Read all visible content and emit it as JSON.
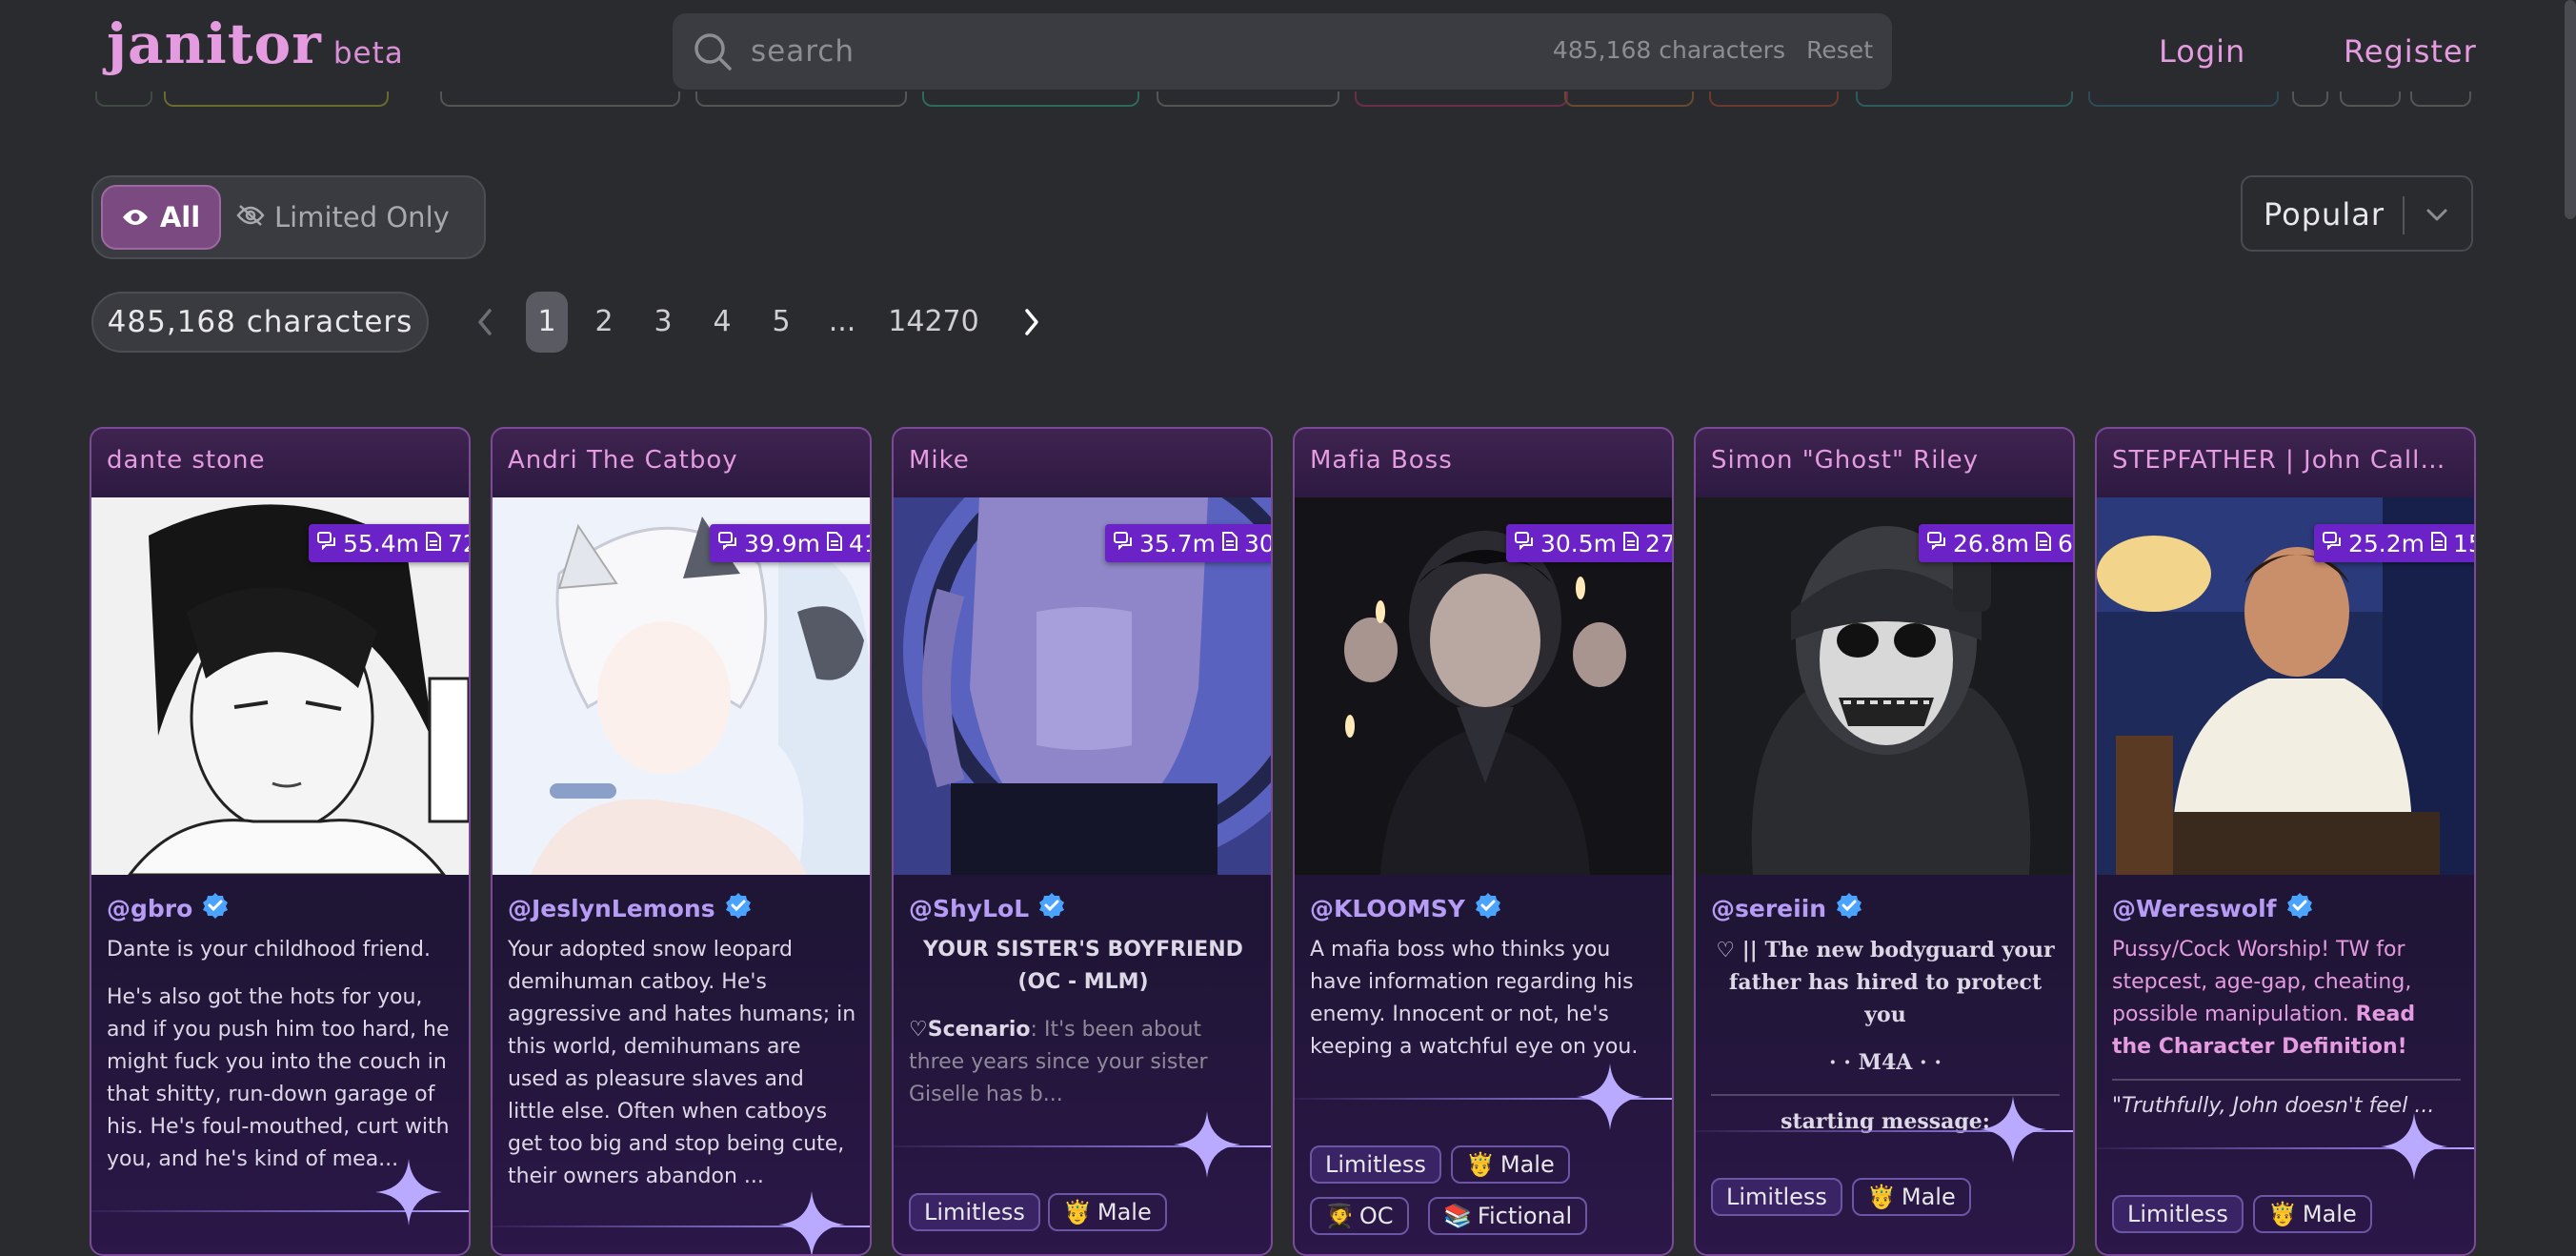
{
  "header": {
    "logo": "janitor",
    "beta": "beta",
    "search_placeholder": "search",
    "search_count": "485,168 characters",
    "reset": "Reset",
    "login": "Login",
    "register": "Register"
  },
  "filters": {
    "all": "All",
    "limited_only": "Limited Only",
    "sort": "Popular"
  },
  "count_badge": "485,168 characters",
  "pagination": {
    "pages": [
      "1",
      "2",
      "3",
      "4",
      "5",
      "...",
      "14270"
    ],
    "current": "1"
  },
  "colors": {
    "accent_pink": "#e59be0",
    "stats_purple": "#6b22c7",
    "author_purple": "#b79cf5",
    "background": "#2a2b2f"
  },
  "cards": [
    {
      "title": "dante stone",
      "chats": "55.4m",
      "messages": "72",
      "author": "@gbro",
      "desc": [
        "Dante is your childhood friend.",
        "He's also got the hots for you, and if you push him too hard, he might fuck you into the couch in that shitty, run-down garage of his. He's foul-mouthed, curt with you, and he's kind of mea..."
      ],
      "tags": []
    },
    {
      "title": "Andri The Catboy",
      "chats": "39.9m",
      "messages": "41",
      "author": "@JeslynLemons",
      "desc": [
        "Your adopted snow leopard demihuman catboy. He's aggressive and hates humans; in this world, demihumans are used as pleasure slaves and little else. Often when catboys get too big and stop being cute, their owners abandon ..."
      ],
      "tags": []
    },
    {
      "title": "Mike",
      "chats": "35.7m",
      "messages": "30",
      "author": "@ShyLoL",
      "heading": "YOUR SISTER'S BOYFRIEND (OC - MLM)",
      "scenario_label": "♡Scenario",
      "scenario_text": ": It's been about three years since your sister Giselle has b...",
      "tags": [
        {
          "icon": "🤴",
          "label": "Limitless"
        },
        {
          "icon": "🤴",
          "label": "Male"
        }
      ]
    },
    {
      "title": "Mafia Boss",
      "chats": "30.5m",
      "messages": "27",
      "author": "@KLOOMSY",
      "desc": [
        "A mafia boss who thinks you have information regarding his enemy. Innocent or not, he's keeping a watchful eye on you."
      ],
      "tags": [
        {
          "icon": "",
          "label": "Limitless"
        },
        {
          "icon": "🤴",
          "label": "Male"
        },
        {
          "icon": "🧑‍🎓",
          "label": "OC"
        },
        {
          "icon": "📚",
          "label": "Fictional"
        }
      ]
    },
    {
      "title": "Simon \"Ghost\" Riley",
      "chats": "26.8m",
      "messages": "6",
      "author": "@sereiin",
      "heading": "♡ || The new bodyguard your father has hired to protect you",
      "subheading": "· · M4A · ·",
      "footer": "starting message:",
      "tags": [
        {
          "icon": "",
          "label": "Limitless"
        },
        {
          "icon": "🤴",
          "label": "Male"
        }
      ]
    },
    {
      "title": "STEPFATHER | John Callow...",
      "chats": "25.2m",
      "messages": "15",
      "author": "@Wereswolf",
      "warning": "Pussy/Cock Worship! TW for stepcest, age-gap, cheating, possible manipulation.",
      "warning_strong": "Read the Character Definition!",
      "quote": "\"Truthfully, John doesn't feel ...",
      "tags": [
        {
          "icon": "",
          "label": "Limitless"
        },
        {
          "icon": "🤴",
          "label": "Male"
        }
      ]
    }
  ]
}
